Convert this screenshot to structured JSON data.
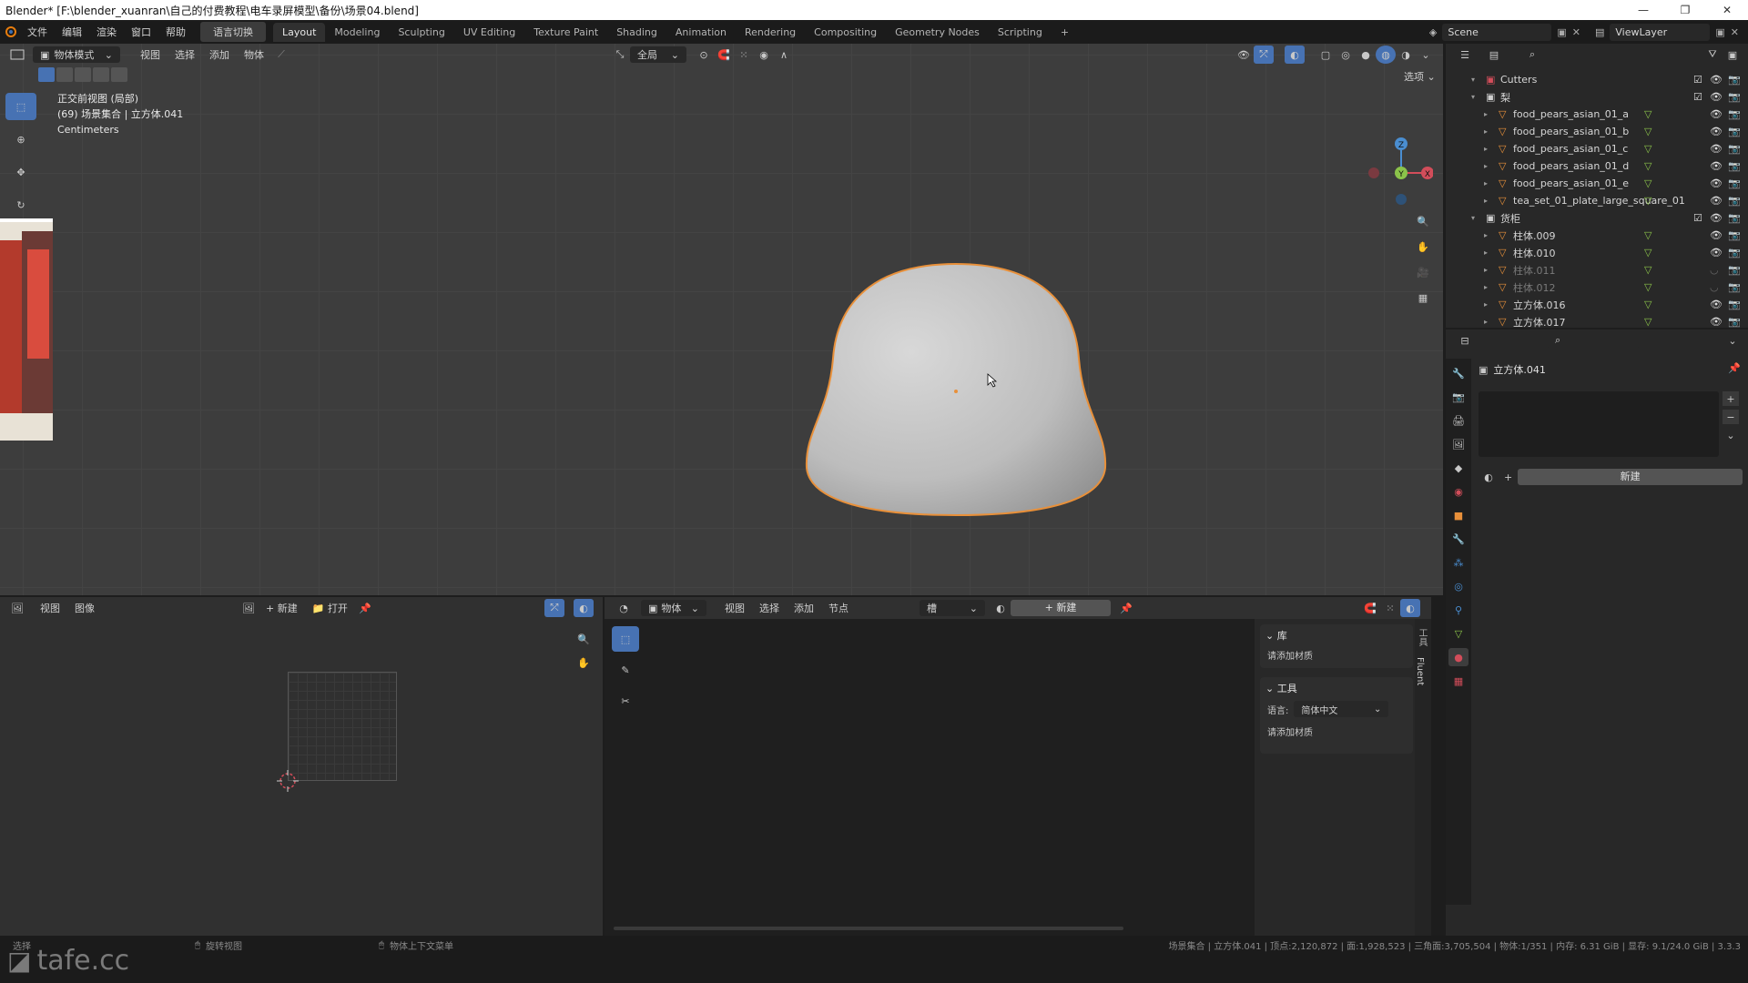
{
  "window": {
    "title": "Blender* [F:\\blender_xuanran\\自己的付费教程\\电车录屏模型\\备份\\场景04.blend]",
    "controls": [
      "—",
      "❐",
      "✕"
    ]
  },
  "menu": {
    "items": [
      "文件",
      "编辑",
      "渲染",
      "窗口",
      "帮助"
    ],
    "lang_button": "语言切换"
  },
  "workspaces": [
    "Layout",
    "Modeling",
    "Sculpting",
    "UV Editing",
    "Texture Paint",
    "Shading",
    "Animation",
    "Rendering",
    "Compositing",
    "Geometry Nodes",
    "Scripting"
  ],
  "active_workspace": "Layout",
  "scene": {
    "label": "Scene",
    "view_layer": "ViewLayer"
  },
  "viewport": {
    "mode": "物体模式",
    "menus": [
      "视图",
      "选择",
      "添加",
      "物体"
    ],
    "transform_global": "全局",
    "options": "选项",
    "hud_line1": "正交前视图 (局部)",
    "hud_line2": "(69) 场景集合 | 立方体.041",
    "hud_line3": "Centimeters",
    "gizmo": {
      "z": "Z",
      "y": "Y",
      "x": "X"
    }
  },
  "outliner": {
    "rows": [
      {
        "name": "Cutters",
        "indent": 0,
        "type": "collection",
        "dim": false
      },
      {
        "name": "梨",
        "indent": 0,
        "type": "collection",
        "dim": false
      },
      {
        "name": "food_pears_asian_01_a",
        "indent": 1,
        "type": "mesh",
        "dim": false
      },
      {
        "name": "food_pears_asian_01_b",
        "indent": 1,
        "type": "mesh",
        "dim": false
      },
      {
        "name": "food_pears_asian_01_c",
        "indent": 1,
        "type": "mesh",
        "dim": false
      },
      {
        "name": "food_pears_asian_01_d",
        "indent": 1,
        "type": "mesh",
        "dim": false
      },
      {
        "name": "food_pears_asian_01_e",
        "indent": 1,
        "type": "mesh",
        "dim": false
      },
      {
        "name": "tea_set_01_plate_large_square_01",
        "indent": 1,
        "type": "mesh",
        "dim": false
      },
      {
        "name": "货柜",
        "indent": 0,
        "type": "collection",
        "dim": false
      },
      {
        "name": "柱体.009",
        "indent": 1,
        "type": "mesh",
        "dim": false
      },
      {
        "name": "柱体.010",
        "indent": 1,
        "type": "mesh",
        "dim": false
      },
      {
        "name": "柱体.011",
        "indent": 1,
        "type": "mesh",
        "dim": true
      },
      {
        "name": "柱体.012",
        "indent": 1,
        "type": "mesh",
        "dim": true
      },
      {
        "name": "立方体.016",
        "indent": 1,
        "type": "mesh",
        "dim": false
      },
      {
        "name": "立方体.017",
        "indent": 1,
        "type": "mesh",
        "dim": false
      }
    ]
  },
  "properties": {
    "object_name": "立方体.041",
    "new_button": "新建"
  },
  "image_editor": {
    "menus": [
      "视图",
      "图像"
    ],
    "new": "新建",
    "open": "打开"
  },
  "node_editor": {
    "object_dropdown": "物体",
    "menus": [
      "视图",
      "选择",
      "添加",
      "节点"
    ],
    "slot": "槽",
    "new": "新建",
    "sidebar": {
      "library_header": "库",
      "library_hint": "请添加材质",
      "tools_header": "工具",
      "language_label": "语言:",
      "language_value": "简体中文",
      "tools_hint": "请添加材质",
      "tab_label": "Fluent"
    }
  },
  "statusbar": {
    "left": "选择",
    "middle1": "旋转视图",
    "middle2": "物体上下文菜单",
    "stats": "场景集合 | 立方体.041 | 顶点:2,120,872 | 面:1,928,523 | 三角面:3,705,504 | 物体:1/351 | 内存: 6.31 GiB | 显存: 9.1/24.0 GiB | 3.3.3"
  },
  "watermark": "tafe.cc",
  "colors": {
    "selection_outline": "#e8903a",
    "viewport_bg": "#3d3d3d",
    "x_axis": "#d24d5a",
    "y_axis": "#8bc34a",
    "z_axis": "#4a8ed1"
  }
}
